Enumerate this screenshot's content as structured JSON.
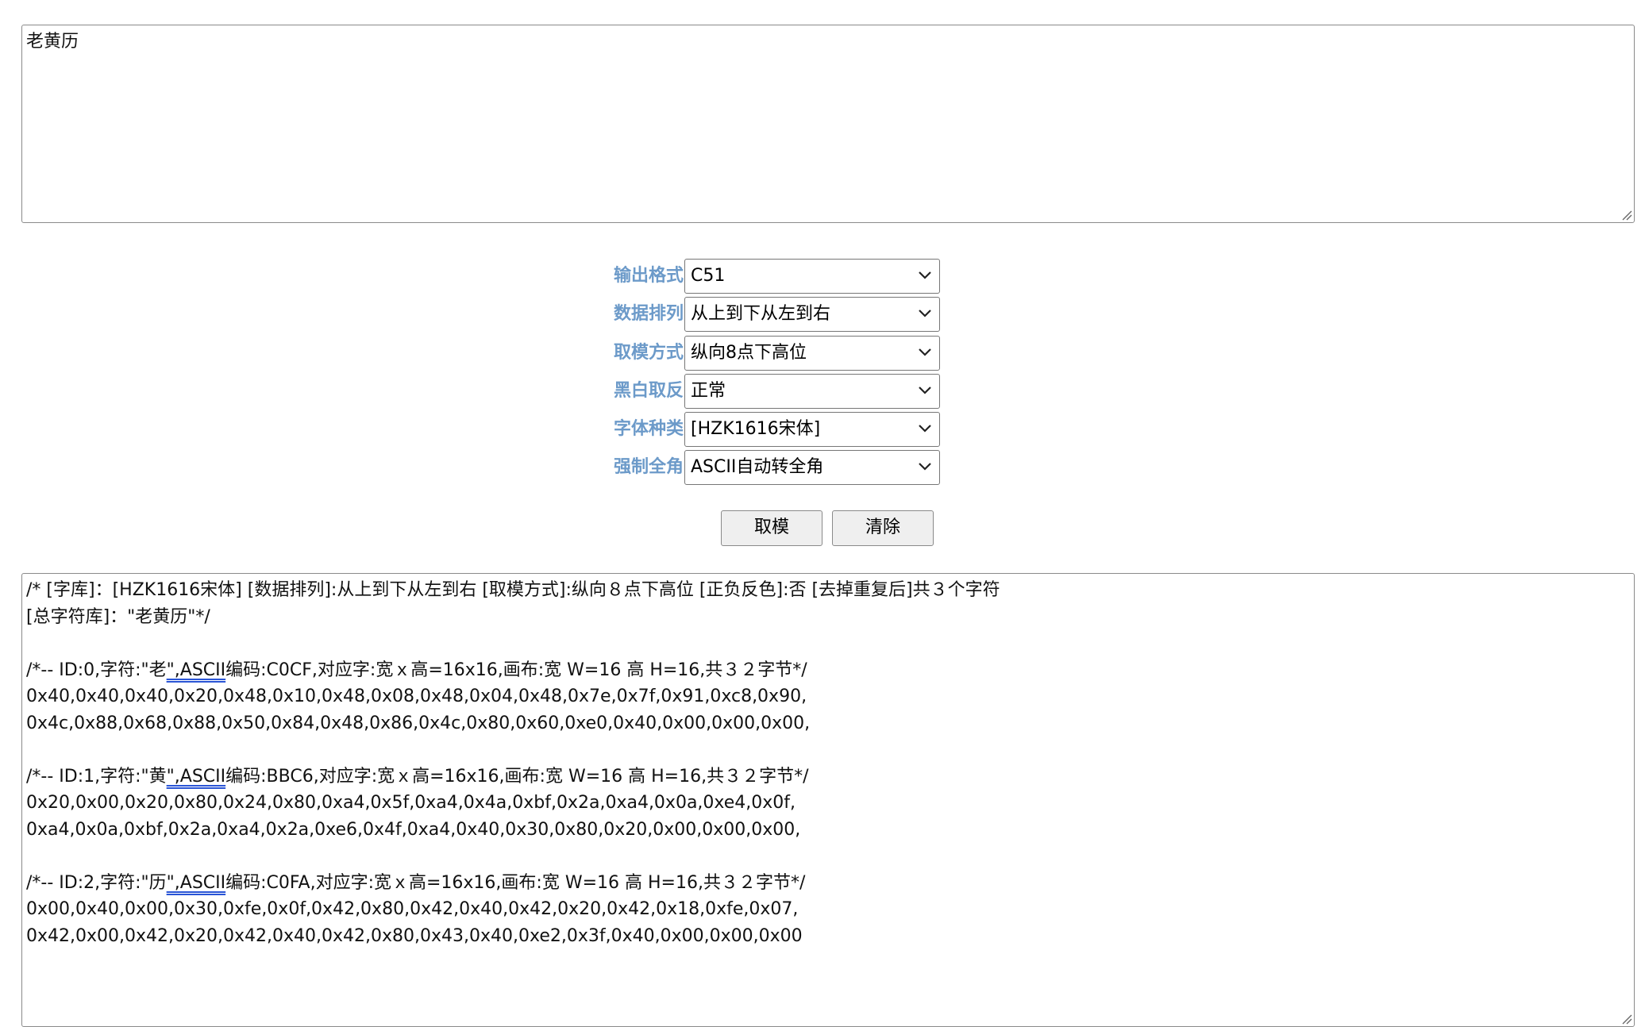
{
  "input": {
    "value": "老黄历"
  },
  "options": [
    {
      "label": "输出格式",
      "value": "C51"
    },
    {
      "label": "数据排列",
      "value": "从上到下从左到右"
    },
    {
      "label": "取模方式",
      "value": "纵向8点下高位"
    },
    {
      "label": "黑白取反",
      "value": "正常"
    },
    {
      "label": "字体种类",
      "value": "[HZK1616宋体]"
    },
    {
      "label": "强制全角",
      "value": "ASCII自动转全角"
    }
  ],
  "buttons": {
    "generate": "取模",
    "clear": "清除"
  },
  "output": {
    "header_line1": "/* [字库]：[HZK1616宋体] [数据排列]:从上到下从左到右 [取模方式]:纵向８点下高位 [正负反色]:否 [去掉重复后]共３个字符",
    "header_line2": "[总字符库]：\"老黄历\"*/",
    "blocks": [
      {
        "comment_pre": "/*-- ID:0,字符:\"老",
        "comment_link": "\",ASCII",
        "comment_post": "编码:C0CF,对应字:宽ｘ高=16x16,画布:宽 W=16 高 H=16,共３２字节*/",
        "line1": "0x40,0x40,0x40,0x20,0x48,0x10,0x48,0x08,0x48,0x04,0x48,0x7e,0x7f,0x91,0xc8,0x90,",
        "line2": "0x4c,0x88,0x68,0x88,0x50,0x84,0x48,0x86,0x4c,0x80,0x60,0xe0,0x40,0x00,0x00,0x00,"
      },
      {
        "comment_pre": "/*-- ID:1,字符:\"黄",
        "comment_link": "\",ASCII",
        "comment_post": "编码:BBC6,对应字:宽ｘ高=16x16,画布:宽 W=16 高 H=16,共３２字节*/",
        "line1": "0x20,0x00,0x20,0x80,0x24,0x80,0xa4,0x5f,0xa4,0x4a,0xbf,0x2a,0xa4,0x0a,0xe4,0x0f,",
        "line2": "0xa4,0x0a,0xbf,0x2a,0xa4,0x2a,0xe6,0x4f,0xa4,0x40,0x30,0x80,0x20,0x00,0x00,0x00,"
      },
      {
        "comment_pre": "/*-- ID:2,字符:\"历",
        "comment_link": "\",ASCII",
        "comment_post": "编码:C0FA,对应字:宽ｘ高=16x16,画布:宽 W=16 高 H=16,共３２字节*/",
        "line1": "0x00,0x40,0x00,0x30,0xfe,0x0f,0x42,0x80,0x42,0x40,0x42,0x20,0x42,0x18,0xfe,0x07,",
        "line2": "0x42,0x00,0x42,0x20,0x42,0x40,0x42,0x80,0x43,0x40,0xe2,0x3f,0x40,0x00,0x00,0x00"
      }
    ]
  },
  "icons": {
    "select_arrow": "chevron-down-icon",
    "textarea_grip": "resize-grip-icon"
  },
  "colors": {
    "label_blue": "#6c9ac9",
    "link_underline": "#2a55d6",
    "button_bg": "#efefef"
  }
}
